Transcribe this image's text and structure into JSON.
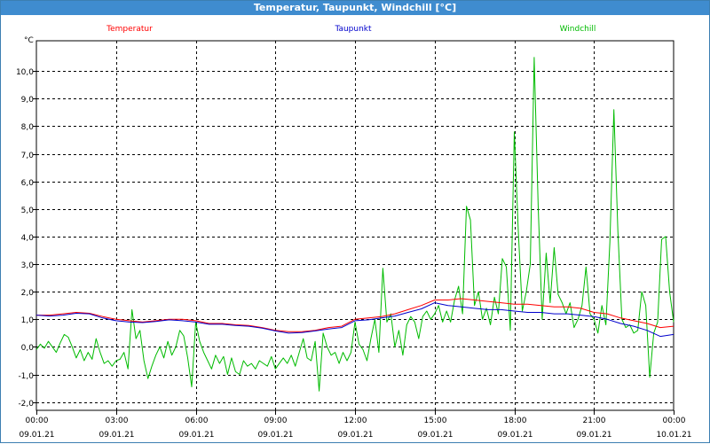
{
  "window": {
    "title": "Temperatur, Taupunkt, Windchill [°C]"
  },
  "chart_data": {
    "type": "line",
    "title": "Temperatur, Taupunkt, Windchill [°C]",
    "ylabel": "°C",
    "ylim": [
      -2.3,
      11.1
    ],
    "y_ticks": [
      -2.0,
      -1.0,
      0.0,
      1.0,
      2.0,
      3.0,
      4.0,
      5.0,
      6.0,
      7.0,
      8.0,
      9.0,
      10.0
    ],
    "y_tick_labels": [
      "-2,0",
      "-1,0",
      "0,0",
      "1,0",
      "2,0",
      "3,0",
      "4,0",
      "5,0",
      "6,0",
      "7,0",
      "8,0",
      "9,0",
      "10,0"
    ],
    "xlim_hours": [
      0,
      24
    ],
    "x_ticks_hours": [
      0,
      3,
      6,
      9,
      12,
      15,
      18,
      21,
      24
    ],
    "x_tick_times": [
      "00:00",
      "03:00",
      "06:00",
      "09:00",
      "12:00",
      "15:00",
      "18:00",
      "21:00",
      "00:00"
    ],
    "x_tick_dates": [
      "09.01.21",
      "09.01.21",
      "09.01.21",
      "09.01.21",
      "09.01.21",
      "09.01.21",
      "09.01.21",
      "09.01.21",
      "10.01.21"
    ],
    "grid": true,
    "legend_position": "top",
    "series": [
      {
        "name": "Temperatur",
        "color": "#ff0000",
        "points": [
          [
            0,
            1.15
          ],
          [
            0.5,
            1.15
          ],
          [
            1,
            1.2
          ],
          [
            1.5,
            1.25
          ],
          [
            2,
            1.22
          ],
          [
            2.5,
            1.1
          ],
          [
            3,
            1.0
          ],
          [
            3.5,
            0.95
          ],
          [
            4,
            0.9
          ],
          [
            4.5,
            0.95
          ],
          [
            5,
            1.0
          ],
          [
            5.5,
            1.0
          ],
          [
            6,
            0.95
          ],
          [
            6.5,
            0.85
          ],
          [
            7,
            0.85
          ],
          [
            7.5,
            0.8
          ],
          [
            8,
            0.78
          ],
          [
            8.5,
            0.7
          ],
          [
            9,
            0.6
          ],
          [
            9.5,
            0.55
          ],
          [
            10,
            0.55
          ],
          [
            10.5,
            0.6
          ],
          [
            11,
            0.7
          ],
          [
            11.5,
            0.75
          ],
          [
            12,
            1.0
          ],
          [
            12.5,
            1.05
          ],
          [
            13,
            1.1
          ],
          [
            13.5,
            1.2
          ],
          [
            14,
            1.35
          ],
          [
            14.5,
            1.5
          ],
          [
            15,
            1.7
          ],
          [
            15.5,
            1.7
          ],
          [
            16,
            1.75
          ],
          [
            16.5,
            1.7
          ],
          [
            17,
            1.65
          ],
          [
            17.5,
            1.6
          ],
          [
            18,
            1.55
          ],
          [
            18.5,
            1.55
          ],
          [
            19,
            1.5
          ],
          [
            19.5,
            1.45
          ],
          [
            20,
            1.45
          ],
          [
            20.5,
            1.4
          ],
          [
            21,
            1.25
          ],
          [
            21.5,
            1.2
          ],
          [
            22,
            1.05
          ],
          [
            22.5,
            0.95
          ],
          [
            23,
            0.85
          ],
          [
            23.5,
            0.7
          ],
          [
            24,
            0.75
          ]
        ]
      },
      {
        "name": "Taupunkt",
        "color": "#0000cc",
        "points": [
          [
            0,
            1.15
          ],
          [
            0.5,
            1.12
          ],
          [
            1,
            1.15
          ],
          [
            1.5,
            1.22
          ],
          [
            2,
            1.2
          ],
          [
            2.5,
            1.05
          ],
          [
            3,
            0.95
          ],
          [
            3.5,
            0.9
          ],
          [
            4,
            0.88
          ],
          [
            4.5,
            0.92
          ],
          [
            5,
            0.98
          ],
          [
            5.5,
            0.95
          ],
          [
            6,
            0.9
          ],
          [
            6.5,
            0.82
          ],
          [
            7,
            0.82
          ],
          [
            7.5,
            0.78
          ],
          [
            8,
            0.75
          ],
          [
            8.5,
            0.68
          ],
          [
            9,
            0.58
          ],
          [
            9.5,
            0.5
          ],
          [
            10,
            0.52
          ],
          [
            10.5,
            0.58
          ],
          [
            11,
            0.65
          ],
          [
            11.5,
            0.7
          ],
          [
            12,
            0.95
          ],
          [
            12.5,
            0.98
          ],
          [
            13,
            1.05
          ],
          [
            13.5,
            1.12
          ],
          [
            14,
            1.25
          ],
          [
            14.5,
            1.38
          ],
          [
            15,
            1.6
          ],
          [
            15.5,
            1.5
          ],
          [
            16,
            1.45
          ],
          [
            16.5,
            1.4
          ],
          [
            17,
            1.35
          ],
          [
            17.5,
            1.35
          ],
          [
            18,
            1.3
          ],
          [
            18.5,
            1.25
          ],
          [
            19,
            1.25
          ],
          [
            19.5,
            1.2
          ],
          [
            20,
            1.2
          ],
          [
            20.5,
            1.15
          ],
          [
            21,
            1.1
          ],
          [
            21.5,
            1.0
          ],
          [
            22,
            0.85
          ],
          [
            22.5,
            0.75
          ],
          [
            23,
            0.6
          ],
          [
            23.5,
            0.38
          ],
          [
            24,
            0.45
          ]
        ]
      },
      {
        "name": "Windchill",
        "color": "#00bb00",
        "points": [
          [
            0,
            -0.1
          ],
          [
            0.15,
            0.1
          ],
          [
            0.3,
            -0.05
          ],
          [
            0.45,
            0.2
          ],
          [
            0.6,
            0.0
          ],
          [
            0.75,
            -0.2
          ],
          [
            0.9,
            0.15
          ],
          [
            1.05,
            0.45
          ],
          [
            1.2,
            0.35
          ],
          [
            1.35,
            0.0
          ],
          [
            1.5,
            -0.4
          ],
          [
            1.65,
            -0.1
          ],
          [
            1.8,
            -0.5
          ],
          [
            1.95,
            -0.2
          ],
          [
            2.1,
            -0.45
          ],
          [
            2.25,
            0.3
          ],
          [
            2.4,
            -0.2
          ],
          [
            2.55,
            -0.6
          ],
          [
            2.7,
            -0.5
          ],
          [
            2.85,
            -0.7
          ],
          [
            3.0,
            -0.5
          ],
          [
            3.15,
            -0.45
          ],
          [
            3.3,
            -0.2
          ],
          [
            3.45,
            -0.8
          ],
          [
            3.6,
            1.35
          ],
          [
            3.75,
            0.3
          ],
          [
            3.9,
            0.6
          ],
          [
            4.05,
            -0.5
          ],
          [
            4.2,
            -1.15
          ],
          [
            4.35,
            -0.7
          ],
          [
            4.5,
            -0.3
          ],
          [
            4.65,
            0.0
          ],
          [
            4.8,
            -0.4
          ],
          [
            4.95,
            0.2
          ],
          [
            5.1,
            -0.3
          ],
          [
            5.25,
            0.0
          ],
          [
            5.4,
            0.6
          ],
          [
            5.55,
            0.4
          ],
          [
            5.7,
            -0.4
          ],
          [
            5.85,
            -1.45
          ],
          [
            6.0,
            0.9
          ],
          [
            6.15,
            0.2
          ],
          [
            6.3,
            -0.2
          ],
          [
            6.45,
            -0.5
          ],
          [
            6.6,
            -0.8
          ],
          [
            6.75,
            -0.3
          ],
          [
            6.9,
            -0.6
          ],
          [
            7.05,
            -0.35
          ],
          [
            7.2,
            -1.0
          ],
          [
            7.35,
            -0.4
          ],
          [
            7.5,
            -0.9
          ],
          [
            7.65,
            -1.0
          ],
          [
            7.8,
            -0.5
          ],
          [
            7.95,
            -0.7
          ],
          [
            8.1,
            -0.6
          ],
          [
            8.25,
            -0.8
          ],
          [
            8.4,
            -0.5
          ],
          [
            8.55,
            -0.6
          ],
          [
            8.7,
            -0.7
          ],
          [
            8.85,
            -0.35
          ],
          [
            9.0,
            -0.8
          ],
          [
            9.15,
            -0.6
          ],
          [
            9.3,
            -0.4
          ],
          [
            9.45,
            -0.6
          ],
          [
            9.6,
            -0.3
          ],
          [
            9.75,
            -0.7
          ],
          [
            9.9,
            -0.2
          ],
          [
            10.05,
            0.3
          ],
          [
            10.2,
            -0.4
          ],
          [
            10.35,
            -0.5
          ],
          [
            10.5,
            0.2
          ],
          [
            10.65,
            -1.6
          ],
          [
            10.8,
            0.5
          ],
          [
            10.95,
            0.0
          ],
          [
            11.1,
            -0.3
          ],
          [
            11.25,
            -0.2
          ],
          [
            11.4,
            -0.6
          ],
          [
            11.55,
            -0.2
          ],
          [
            11.7,
            -0.5
          ],
          [
            11.85,
            -0.2
          ],
          [
            12.0,
            0.9
          ],
          [
            12.15,
            0.1
          ],
          [
            12.3,
            -0.1
          ],
          [
            12.45,
            -0.5
          ],
          [
            12.6,
            0.3
          ],
          [
            12.75,
            1.0
          ],
          [
            12.9,
            -0.2
          ],
          [
            13.05,
            2.85
          ],
          [
            13.2,
            0.9
          ],
          [
            13.35,
            1.2
          ],
          [
            13.5,
            0.0
          ],
          [
            13.65,
            0.6
          ],
          [
            13.8,
            -0.3
          ],
          [
            13.95,
            0.8
          ],
          [
            14.1,
            1.1
          ],
          [
            14.25,
            0.9
          ],
          [
            14.4,
            0.3
          ],
          [
            14.55,
            1.1
          ],
          [
            14.7,
            1.3
          ],
          [
            14.85,
            1.0
          ],
          [
            15.0,
            1.2
          ],
          [
            15.15,
            1.5
          ],
          [
            15.3,
            0.9
          ],
          [
            15.45,
            1.3
          ],
          [
            15.6,
            0.9
          ],
          [
            15.75,
            1.7
          ],
          [
            15.9,
            2.2
          ],
          [
            16.05,
            1.2
          ],
          [
            16.2,
            5.1
          ],
          [
            16.35,
            4.6
          ],
          [
            16.5,
            1.5
          ],
          [
            16.65,
            2.0
          ],
          [
            16.8,
            1.0
          ],
          [
            16.95,
            1.4
          ],
          [
            17.1,
            0.8
          ],
          [
            17.25,
            1.8
          ],
          [
            17.4,
            1.2
          ],
          [
            17.55,
            3.2
          ],
          [
            17.7,
            2.9
          ],
          [
            17.85,
            0.6
          ],
          [
            18.0,
            7.8
          ],
          [
            18.15,
            4.2
          ],
          [
            18.3,
            1.3
          ],
          [
            18.45,
            2.0
          ],
          [
            18.6,
            3.0
          ],
          [
            18.75,
            10.5
          ],
          [
            18.9,
            5.1
          ],
          [
            19.05,
            1.0
          ],
          [
            19.2,
            3.4
          ],
          [
            19.35,
            1.6
          ],
          [
            19.5,
            3.6
          ],
          [
            19.65,
            1.9
          ],
          [
            19.8,
            1.6
          ],
          [
            19.95,
            1.2
          ],
          [
            20.1,
            1.6
          ],
          [
            20.25,
            0.7
          ],
          [
            20.4,
            1.0
          ],
          [
            20.55,
            1.5
          ],
          [
            20.7,
            2.9
          ],
          [
            20.85,
            1.2
          ],
          [
            21.0,
            1.0
          ],
          [
            21.15,
            0.5
          ],
          [
            21.3,
            1.5
          ],
          [
            21.45,
            0.8
          ],
          [
            21.6,
            3.8
          ],
          [
            21.75,
            8.6
          ],
          [
            21.9,
            4.2
          ],
          [
            22.05,
            1.0
          ],
          [
            22.2,
            0.7
          ],
          [
            22.35,
            0.8
          ],
          [
            22.5,
            0.5
          ],
          [
            22.65,
            0.6
          ],
          [
            22.8,
            2.0
          ],
          [
            22.95,
            1.5
          ],
          [
            23.1,
            -1.1
          ],
          [
            23.25,
            0.5
          ],
          [
            23.4,
            0.9
          ],
          [
            23.55,
            3.9
          ],
          [
            23.7,
            4.0
          ],
          [
            23.85,
            2.0
          ],
          [
            24.0,
            0.9
          ]
        ]
      }
    ]
  }
}
